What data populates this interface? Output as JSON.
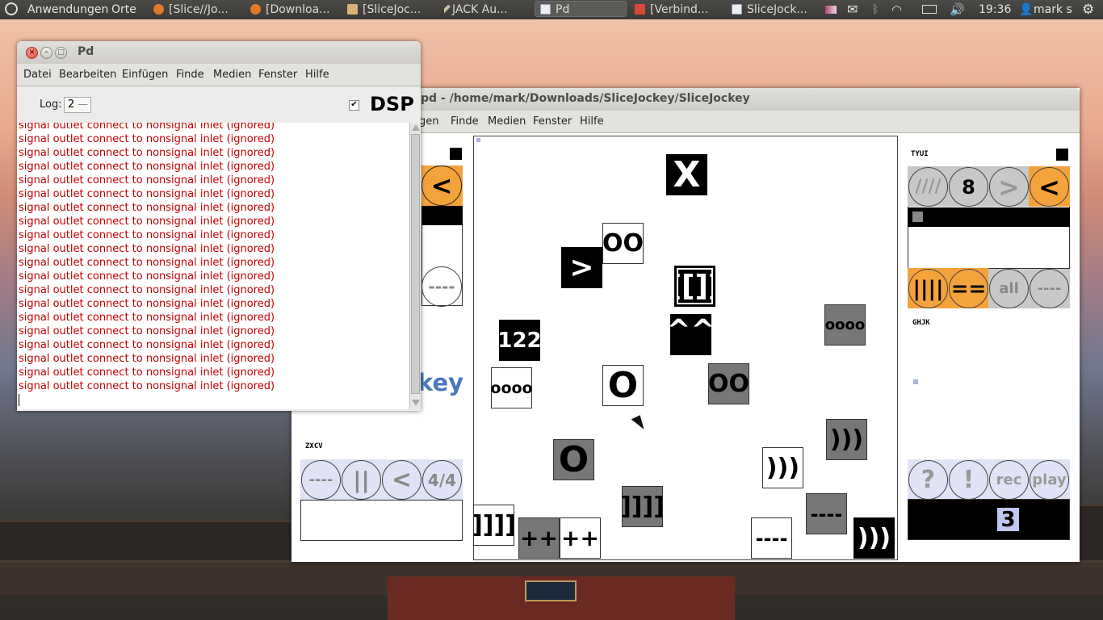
{
  "top_panel": {
    "menu_apps": "Anwendungen",
    "menu_places": "Orte",
    "tasks": [
      "[Slice//Jo...",
      "[Downloa...",
      "[SliceJoc...",
      "JACK Au...",
      "Pd",
      "[Verbind...",
      "SliceJock..."
    ],
    "clock": "19:36",
    "user": "mark s"
  },
  "pd_main": {
    "title": "Pd",
    "menu": [
      "Datei",
      "Bearbeiten",
      "Einfügen",
      "Finde",
      "Medien",
      "Fenster",
      "Hilfe"
    ],
    "log_label": "Log:",
    "log_value": "2",
    "dsp_label": "DSP",
    "dsp_checked": true,
    "log_lines": [
      "signal outlet connect to nonsignal inlet (ignored)",
      "signal outlet connect to nonsignal inlet (ignored)",
      "signal outlet connect to nonsignal inlet (ignored)",
      "signal outlet connect to nonsignal inlet (ignored)",
      "signal outlet connect to nonsignal inlet (ignored)",
      "signal outlet connect to nonsignal inlet (ignored)",
      "signal outlet connect to nonsignal inlet (ignored)",
      "signal outlet connect to nonsignal inlet (ignored)",
      "signal outlet connect to nonsignal inlet (ignored)",
      "signal outlet connect to nonsignal inlet (ignored)",
      "signal outlet connect to nonsignal inlet (ignored)",
      "signal outlet connect to nonsignal inlet (ignored)",
      "signal outlet connect to nonsignal inlet (ignored)",
      "signal outlet connect to nonsignal inlet (ignored)",
      "signal outlet connect to nonsignal inlet (ignored)",
      "signal outlet connect to nonsignal inlet (ignored)",
      "signal outlet connect to nonsignal inlet (ignored)",
      "signal outlet connect to nonsignal inlet (ignored)",
      "signal outlet connect to nonsignal inlet (ignored)",
      "signal outlet connect to nonsignal inlet (ignored)"
    ]
  },
  "patch": {
    "title": "pd  - /home/mark/Downloads/SliceJockey/SliceJockey",
    "menu": [
      "gen",
      "Finde",
      "Medien",
      "Fenster",
      "Hilfe"
    ],
    "left": {
      "arrow": "<",
      "dash": "----",
      "partial_title": "key",
      "zxcv_label": "ZXCV",
      "zxcv_buttons": [
        "----",
        "||",
        "<",
        "4/4"
      ]
    },
    "canvas": {
      "x": "X",
      "oo_top": "OO",
      "gt": ">",
      "brackets": "[[]]",
      "caret": "^^",
      "n122": "122",
      "oooo_left": "oooo",
      "o_center": "O",
      "oo_gray": "OO",
      "oooo_right": "oooo",
      "paren_gray": ")))",
      "paren_white": ")))",
      "o_gray": "O",
      "bracket_gray": "]]]]",
      "dash_gray": "----",
      "bracket_white": "]]]]",
      "plus_gray": "++",
      "plus_white": "++",
      "dash_white": "----",
      "paren_black": ")))"
    },
    "right": {
      "tyui_label": "TYUI",
      "tyui_buttons": [
        "////",
        "8",
        ">",
        "<"
      ],
      "bottom_buttons": [
        "||||",
        "==",
        "all",
        "----"
      ],
      "ghjk_label": "GHJK",
      "transport": [
        "?",
        "!",
        "rec",
        "play"
      ],
      "number": "3"
    }
  }
}
